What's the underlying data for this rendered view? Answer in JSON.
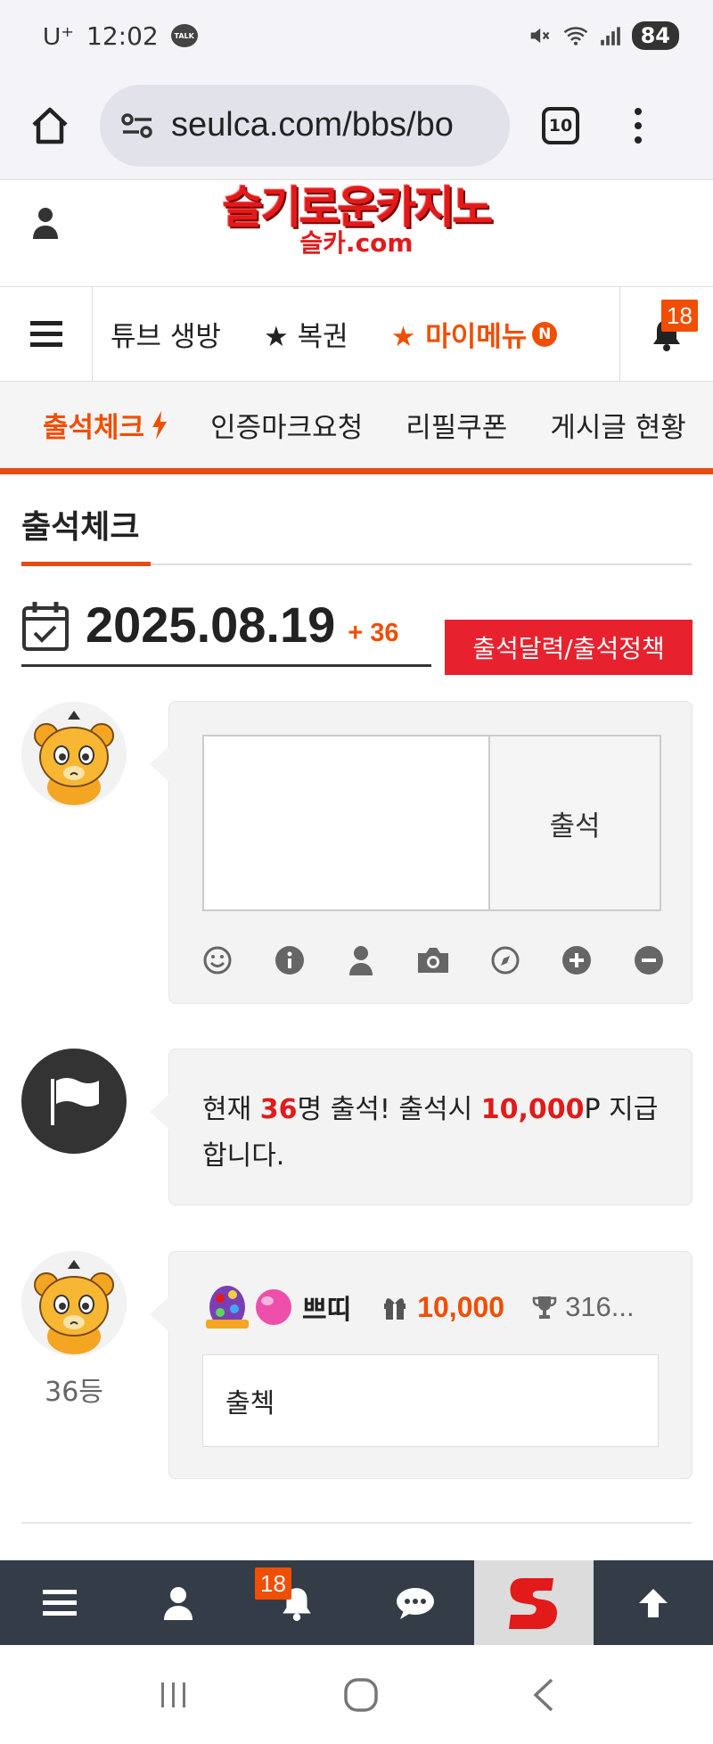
{
  "status_bar": {
    "carrier": "U⁺",
    "time": "12:02",
    "talk_label": "TALK",
    "battery": "84",
    "icons": [
      "kakaotalk-icon",
      "mute-icon",
      "wifi-icon",
      "signal-icon",
      "battery-icon"
    ]
  },
  "browser": {
    "url": "seulca.com/bbs/bo",
    "tab_count": "10"
  },
  "site": {
    "logo_main": "슬기로운카지노",
    "logo_sub": "슬카.com"
  },
  "main_nav": {
    "items": [
      {
        "label": "튜브 생방"
      },
      {
        "label": "★ 복권"
      },
      {
        "label": "★ 마이메뉴",
        "badge": "N"
      }
    ],
    "notification_count": "18"
  },
  "sub_nav": {
    "items": [
      "출석체크",
      "인증마크요청",
      "리필쿠폰",
      "게시글 현황"
    ]
  },
  "page": {
    "title": "출석체크",
    "date": "2025.08.19",
    "date_plus": "+ 36",
    "policy_button": "출석달력/출석정책"
  },
  "attend_form": {
    "textarea_value": "",
    "submit_label": "출석",
    "toolbar_icons": [
      "smile-icon",
      "info-icon",
      "user-icon",
      "camera-icon",
      "compass-icon",
      "plus-circle-icon",
      "minus-circle-icon"
    ]
  },
  "notice": {
    "prefix": "현재 ",
    "count": "36",
    "mid": "명 출석! 출석시 ",
    "points": "10,000",
    "suffix": "P 지급합니다."
  },
  "entry": {
    "rank": "36등",
    "username": "쁘띠",
    "points": "10,000",
    "trophy_value": "316...",
    "comment": "출첵"
  },
  "bottom_bar": {
    "notification_count": "18",
    "icons": [
      "menu-icon",
      "user-icon",
      "bell-icon",
      "chat-icon",
      "site-logo",
      "arrow-up-icon"
    ]
  },
  "colors": {
    "accent": "#f04e00",
    "red": "#e8212e",
    "bottom_bar": "#343d47"
  }
}
